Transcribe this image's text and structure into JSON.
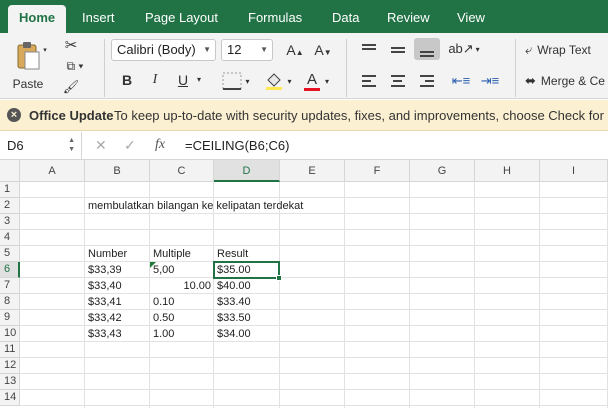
{
  "ribbon_tabs": [
    "Home",
    "Insert",
    "Page Layout",
    "Formulas",
    "Data",
    "Review",
    "View"
  ],
  "ribbon": {
    "paste_label": "Paste",
    "font_name": "Calibri (Body)",
    "font_size": "12",
    "bold": "B",
    "italic": "I",
    "underline": "U",
    "wrap_text": "Wrap Text",
    "merge_center": "Merge & Ce",
    "font_color": "#e81123",
    "accent": "#217346"
  },
  "message_bar": {
    "title": "Office Update",
    "text": "To keep up-to-date with security updates, fixes, and improvements, choose Check for Updates."
  },
  "formula_bar": {
    "name_box": "D6",
    "fx": "fx",
    "formula": "=CEILING(B6;C6)"
  },
  "grid": {
    "columns": [
      "A",
      "B",
      "C",
      "D",
      "E",
      "F",
      "G",
      "H",
      "I"
    ],
    "rows": [
      "1",
      "2",
      "3",
      "4",
      "5",
      "6",
      "7",
      "8",
      "9",
      "10",
      "11",
      "12",
      "13",
      "14"
    ],
    "selected_cell": "D6",
    "cells": {
      "B2": "membulatkan bilangan ke kelipatan terdekat",
      "B5": "Number",
      "C5": "Multiple",
      "D5": "Result",
      "B6": "$33,39",
      "C6": "5,00",
      "D6": "$35.00",
      "B7": "$33,40",
      "C7": "10.00",
      "D7": "$40.00",
      "B8": "$33,41",
      "C8": "0.10",
      "D8": "$33.40",
      "B9": "$33,42",
      "C9": "0.50",
      "D9": "$33.50",
      "B10": "$33,43",
      "C10": "1.00",
      "D10": "$34.00"
    }
  }
}
